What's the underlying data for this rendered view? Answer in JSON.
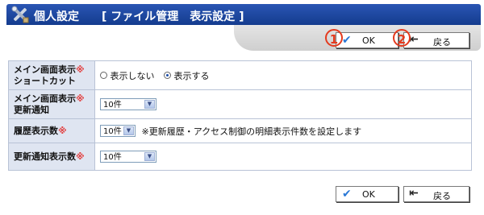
{
  "header": {
    "title": "個人設定",
    "subtitle": "[ ファイル管理　表示設定 ]",
    "icon": "tools-icon"
  },
  "buttons": {
    "ok_label": "OK",
    "back_label": "戻る"
  },
  "annotations": {
    "badge1": "1",
    "badge2": "2"
  },
  "rows": [
    {
      "label_line1": "メイン画面表示",
      "label_line2": "ショートカット",
      "required_mark": "※",
      "options": [
        "表示しない",
        "表示する"
      ],
      "selected": "表示する"
    },
    {
      "label_line1": "メイン画面表示",
      "label_line2": "更新通知",
      "required_mark": "※",
      "value": "10件"
    },
    {
      "label_line1": "履歴表示数",
      "required_mark": "※",
      "value": "10件",
      "note": "※更新履歴・アクセス制御の明細表示件数を設定します"
    },
    {
      "label_line1": "更新通知表示数",
      "required_mark": "※",
      "value": "10件"
    }
  ],
  "colors": {
    "header_bg": "#1e4aa2",
    "label_bg": "#dfe5f1",
    "required": "#e23c3c",
    "badge": "#e43a1e"
  }
}
